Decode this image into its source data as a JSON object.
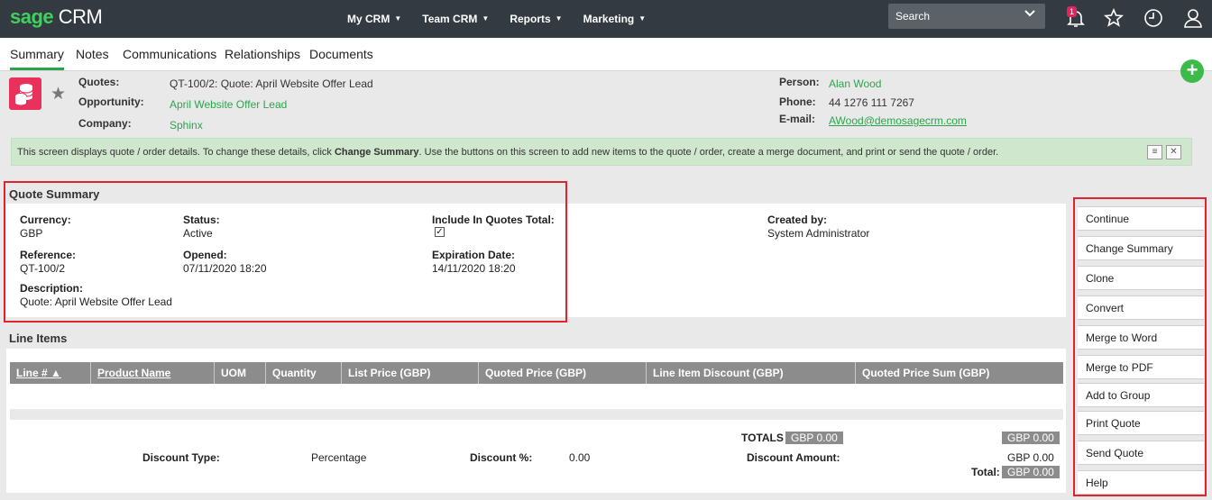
{
  "topbar": {
    "logo_brand": "sage",
    "logo_product": "CRM",
    "nav": [
      {
        "label": "My CRM"
      },
      {
        "label": "Team CRM"
      },
      {
        "label": "Reports"
      },
      {
        "label": "Marketing"
      }
    ],
    "search_placeholder": "Search",
    "notification_count": "1",
    "icons": [
      "bell-icon",
      "star-icon",
      "clock-icon",
      "user-icon"
    ]
  },
  "tabs": [
    {
      "label": "Summary",
      "active": true
    },
    {
      "label": "Notes"
    },
    {
      "label": "Communications"
    },
    {
      "label": "Relationships"
    },
    {
      "label": "Documents"
    }
  ],
  "header": {
    "quotes_label": "Quotes:",
    "quotes_value": "QT-100/2: Quote: April Website Offer Lead",
    "opportunity_label": "Opportunity:",
    "opportunity_value": "April Website Offer Lead",
    "company_label": "Company:",
    "company_value": "Sphinx",
    "person_label": "Person:",
    "person_value": "Alan Wood",
    "phone_label": "Phone:",
    "phone_value": "44 1276 111 7267",
    "email_label": "E-mail:",
    "email_value": "AWood@demosagecrm.com"
  },
  "info": {
    "text_before": "This screen displays quote / order details. To change these details, click ",
    "text_bold": "Change Summary",
    "text_after": ". Use the buttons on this screen to add new items to the quote / order, create a merge document, and print or send the quote / order."
  },
  "summary": {
    "title": "Quote Summary",
    "currency_label": "Currency:",
    "currency_value": "GBP",
    "status_label": "Status:",
    "status_value": "Active",
    "include_label": "Include In Quotes Total:",
    "include_checked": true,
    "created_label": "Created by:",
    "created_value": "System Administrator",
    "reference_label": "Reference:",
    "reference_value": "QT-100/2",
    "opened_label": "Opened:",
    "opened_value": "07/11/2020 18:20",
    "expiration_label": "Expiration Date:",
    "expiration_value": "14/11/2020 18:20",
    "description_label": "Description:",
    "description_value": "Quote: April Website Offer Lead"
  },
  "line_items": {
    "title": "Line Items",
    "columns": [
      "Line #",
      "Product Name",
      "UOM",
      "Quantity",
      "List Price (GBP)",
      "Quoted Price (GBP)",
      "Line Item Discount (GBP)",
      "Quoted Price Sum (GBP)"
    ]
  },
  "totals": {
    "totals_label": "TOTALS",
    "totals_value": "GBP 0.00",
    "right_total": "GBP 0.00",
    "discount_type_label": "Discount Type:",
    "discount_type_value": "Percentage",
    "discount_pct_label": "Discount %:",
    "discount_pct_value": "0.00",
    "discount_amount_label": "Discount Amount:",
    "discount_amount_value": "GBP 0.00",
    "total_label": "Total:",
    "total_value": "GBP 0.00"
  },
  "actions": [
    "Continue",
    "Change Summary",
    "Clone",
    "Convert",
    "Merge to Word",
    "Merge to PDF",
    "Add to Group",
    "Print Quote",
    "Send Quote",
    "Help"
  ]
}
